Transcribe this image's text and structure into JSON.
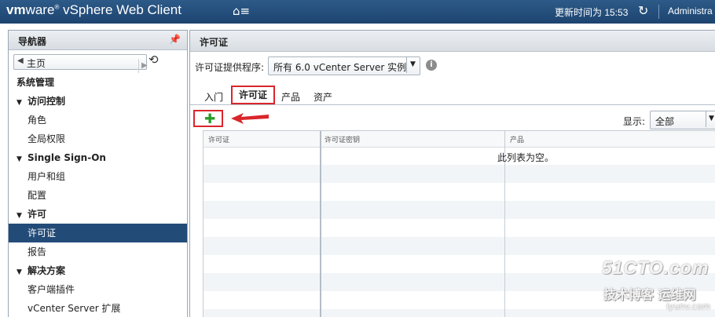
{
  "header": {
    "brand_vm": "vm",
    "brand_ware": "ware",
    "brand_reg": "®",
    "brand_product": "vSphere Web Client",
    "home_glyph": "⌂≡",
    "update_time": "更新时间为 15:53",
    "user": "Administra"
  },
  "navigator": {
    "title": "导航器",
    "back_label": "主页",
    "items": [
      {
        "label": "系统管理",
        "kind": "section"
      },
      {
        "label": "访问控制",
        "kind": "group"
      },
      {
        "label": "角色",
        "kind": "leaf"
      },
      {
        "label": "全局权限",
        "kind": "leaf"
      },
      {
        "label": "Single Sign-On",
        "kind": "group"
      },
      {
        "label": "用户和组",
        "kind": "leaf"
      },
      {
        "label": "配置",
        "kind": "leaf"
      },
      {
        "label": "许可",
        "kind": "group"
      },
      {
        "label": "许可证",
        "kind": "leaf",
        "selected": true
      },
      {
        "label": "报告",
        "kind": "leaf"
      },
      {
        "label": "解决方案",
        "kind": "group"
      },
      {
        "label": "客户端插件",
        "kind": "leaf"
      },
      {
        "label": "vCenter Server 扩展",
        "kind": "leaf"
      }
    ]
  },
  "main": {
    "title": "许可证",
    "provider_label": "许可证提供程序:",
    "provider_value": "所有 6.0 vCenter Server 实例",
    "tabs": [
      {
        "label": "入门"
      },
      {
        "label": "许可证",
        "active": true
      },
      {
        "label": "产品"
      },
      {
        "label": "资产"
      }
    ],
    "show_label": "显示:",
    "show_value": "全部",
    "table": {
      "columns": [
        "许可证",
        "许可证密钥",
        "产品"
      ],
      "empty_message": "此列表为空。"
    }
  },
  "watermark": {
    "top": "51CTO.com",
    "bottom": "技术博客 运维网",
    "site": "iyunv.com"
  },
  "colors": {
    "topbar": "#1d4470",
    "selected_nav": "#234b78",
    "highlight_red": "#d9262b",
    "add_green": "#2a9a2a"
  }
}
